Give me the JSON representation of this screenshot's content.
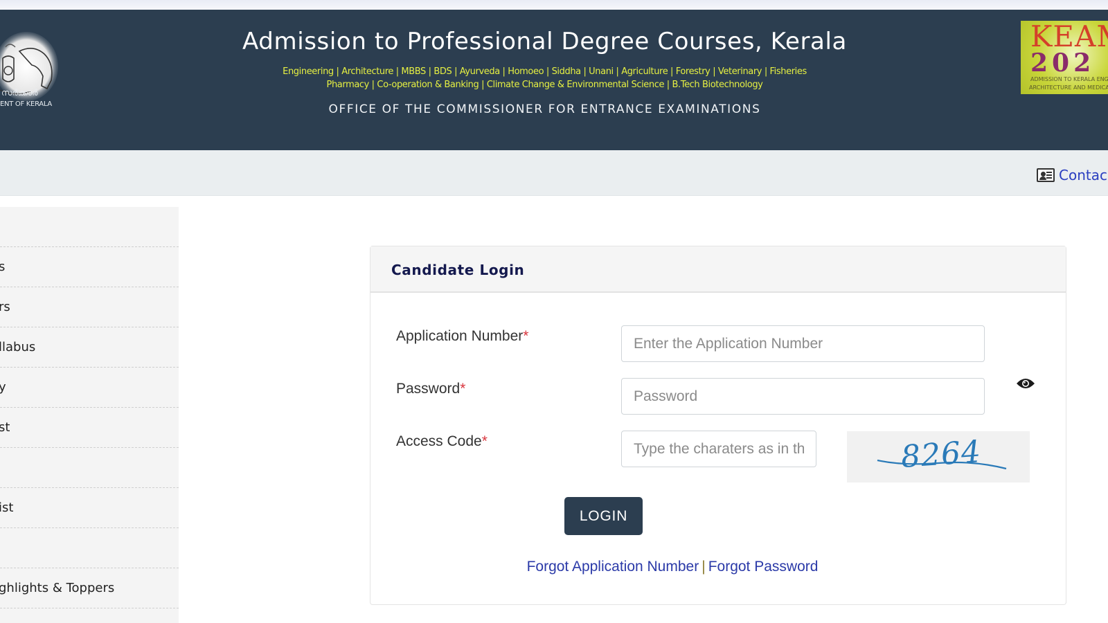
{
  "header": {
    "emblem_caption_line1": "സർക്കാർ",
    "emblem_caption_line2": "ENT OF KERALA",
    "title": "Admission to Professional Degree Courses, Kerala",
    "courses_line1": "Engineering | Architecture | MBBS | BDS | Ayurveda | Homoeo | Siddha | Unani | Agriculture | Forestry | Veterinary | Fisheries",
    "courses_line2": "Pharmacy | Co-operation & Banking | Climate Change & Environmental Science | B.Tech Biotechnology",
    "office": "OFFICE OF THE COMMISSIONER FOR ENTRANCE EXAMINATIONS",
    "logo": {
      "line1": "KEAM",
      "line2": "202",
      "line3": "ADMISSION TO KERALA ENGIN",
      "line4": "ARCHITECTURE AND MEDICAL"
    }
  },
  "navbar": {
    "contact_label": "Contac"
  },
  "sidebar": {
    "items": [
      {
        "label": ""
      },
      {
        "label": "s"
      },
      {
        "label": "rs"
      },
      {
        "label": "llabus"
      },
      {
        "label": "y"
      },
      {
        "label": "st"
      },
      {
        "label": ""
      },
      {
        "label": "ist"
      },
      {
        "label": ""
      },
      {
        "label": "ghlights & Toppers"
      }
    ]
  },
  "login": {
    "title": "Candidate Login",
    "fields": {
      "application_number": {
        "label": "Application Number",
        "required_mark": "*",
        "placeholder": "Enter the Application Number",
        "value": ""
      },
      "password": {
        "label": "Password",
        "required_mark": "*",
        "placeholder": "Password",
        "value": ""
      },
      "access_code": {
        "label": "Access Code",
        "required_mark": "*",
        "placeholder": "Type the charaters as in the image",
        "value": ""
      }
    },
    "captcha_text": "8264",
    "login_button": "LOGIN",
    "forgot_application": "Forgot Application Number",
    "separator": "|",
    "forgot_password": "Forgot Password"
  },
  "colors": {
    "header_bg": "#2c3e50",
    "courses_text": "#e6f042",
    "link": "#2b3aa8",
    "required": "#d9363e",
    "button_bg": "#2c3e50"
  }
}
